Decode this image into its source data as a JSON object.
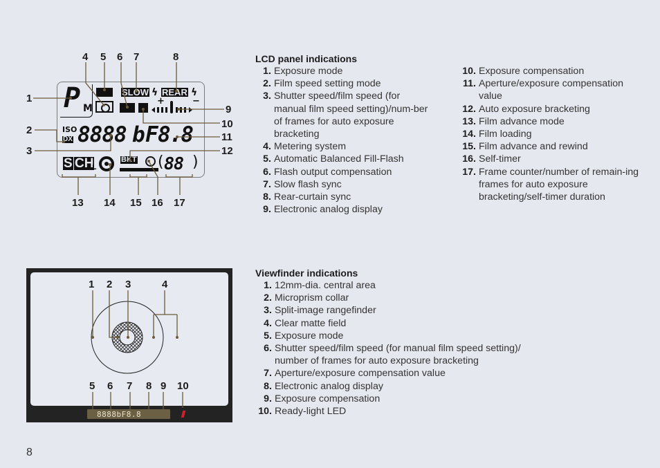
{
  "lcd_panel": {
    "title": "LCD panel indications",
    "items": [
      {
        "num": "1.",
        "text": "Exposure mode"
      },
      {
        "num": "2.",
        "text": "Film speed setting mode"
      },
      {
        "num": "3.",
        "text": "Shutter speed/film speed (for manual film speed setting)/num-ber of frames for auto exposure bracketing"
      },
      {
        "num": "4.",
        "text": "Metering system"
      },
      {
        "num": "5.",
        "text": "Automatic Balanced Fill-Flash"
      },
      {
        "num": "6.",
        "text": "Flash output compensation"
      },
      {
        "num": "7.",
        "text": "Slow flash sync"
      },
      {
        "num": "8.",
        "text": "Rear-curtain sync"
      },
      {
        "num": "9.",
        "text": "Electronic analog display"
      },
      {
        "num": "10.",
        "text": "Exposure compensation"
      },
      {
        "num": "11.",
        "text": "Aperture/exposure compensation value"
      },
      {
        "num": "12.",
        "text": "Auto exposure bracketing"
      },
      {
        "num": "13.",
        "text": "Film advance mode"
      },
      {
        "num": "14.",
        "text": "Film loading"
      },
      {
        "num": "15.",
        "text": "Film advance and rewind"
      },
      {
        "num": "16.",
        "text": "Self-timer"
      },
      {
        "num": "17.",
        "text": "Frame counter/number of remain-ing frames for auto exposure bracketing/self-timer duration"
      }
    ],
    "diagram": {
      "callouts": [
        "1",
        "2",
        "3",
        "4",
        "5",
        "6",
        "7",
        "8",
        "9",
        "10",
        "11",
        "12",
        "13",
        "14",
        "15",
        "16",
        "17"
      ],
      "glyphs": {
        "mode_letter": "P",
        "mode_sub": "M",
        "iso": "ISO",
        "dx": "DX",
        "shutter_digits": "8888",
        "b_glyph": "b",
        "f_glyph": "F",
        "aperture_digits": "8.8",
        "slow": "SLOW",
        "rear": "REAR",
        "flash_bolt": "ϟ",
        "plus": "+",
        "minus": "−",
        "film_mode_s": "S",
        "film_mode_ch": "CH",
        "film_mode_cl": "L",
        "bkt": "BKT",
        "frame_digits": "88",
        "paren_open": "(",
        "paren_close": ")"
      }
    }
  },
  "viewfinder": {
    "title": "Viewfinder indications",
    "items": [
      {
        "num": "1.",
        "text": "12mm-dia. central area"
      },
      {
        "num": "2.",
        "text": "Microprism collar"
      },
      {
        "num": "3.",
        "text": "Split-image rangefinder"
      },
      {
        "num": "4.",
        "text": "Clear matte field"
      },
      {
        "num": "5.",
        "text": "Exposure mode"
      },
      {
        "num": "6.",
        "text": "Shutter speed/film speed (for manual film speed setting)/ number of frames for auto exposure bracketing"
      },
      {
        "num": "7.",
        "text": "Aperture/exposure compensation value"
      },
      {
        "num": "8.",
        "text": "Electronic analog display"
      },
      {
        "num": "9.",
        "text": "Exposure compensation"
      },
      {
        "num": "10.",
        "text": "Ready-light LED"
      }
    ],
    "diagram": {
      "top_callouts": [
        "1",
        "2",
        "3",
        "4"
      ],
      "bottom_callouts": [
        "5",
        "6",
        "7",
        "8",
        "9",
        "10"
      ],
      "display_readout": "8888bF8.8",
      "led_color": "#d0202a"
    }
  },
  "page": {
    "number": "8",
    "background": "#e6e8ef",
    "leader_color": "#6b5a3a"
  }
}
